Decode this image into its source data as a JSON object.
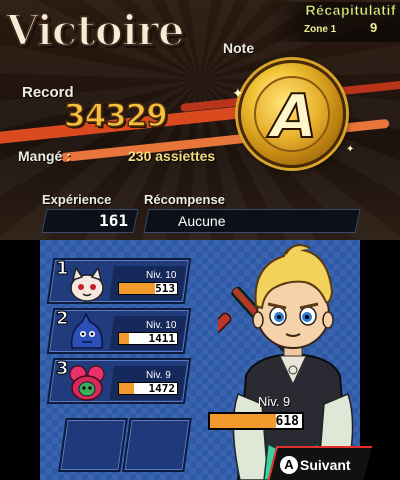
{
  "header": {
    "title": "Victoire",
    "recap_label": "Récapitulatif",
    "zone_label": "Zone 1",
    "zone_number": "9"
  },
  "results": {
    "note_label": "Note",
    "grade": "A",
    "record_label": "Record",
    "score": "34329",
    "eaten_label": "Mangé :",
    "eaten_value": "230 assiettes",
    "experience_label": "Expérience",
    "experience_value": "161",
    "reward_label": "Récompense",
    "reward_value": "Aucune"
  },
  "party": [
    {
      "slot": "1",
      "level": "Niv. 10",
      "hp": "513",
      "hp_fraction": 0.62,
      "icon": "cat-yokai-icon"
    },
    {
      "slot": "2",
      "level": "Niv. 10",
      "hp": "1411",
      "hp_fraction": 0.18,
      "icon": "blue-yokai-icon"
    },
    {
      "slot": "3",
      "level": "Niv. 9",
      "hp": "1472",
      "hp_fraction": 0.26,
      "icon": "flower-yokai-icon"
    }
  ],
  "hero": {
    "level": "Niv. 9",
    "hp": "618",
    "hp_fraction": 0.72
  },
  "next_button": {
    "key": "A",
    "label": "Suivant"
  },
  "colors": {
    "hp_fill": "#f39a2c",
    "panel_blue": "#2e5aa8",
    "gold": "#f2c638",
    "accent_red": "#e23030"
  }
}
